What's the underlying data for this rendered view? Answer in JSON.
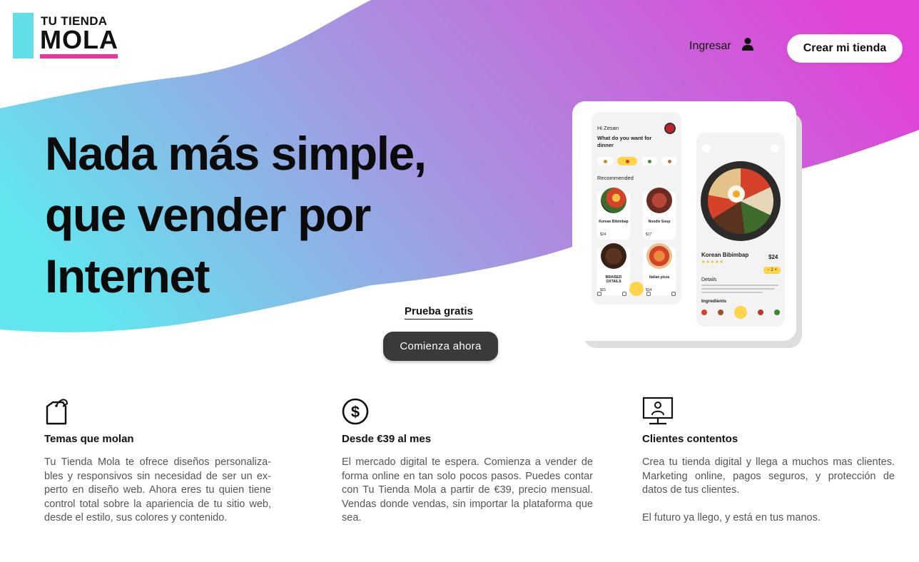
{
  "brand": {
    "line1": "TU TIENDA",
    "line2": "MOLA",
    "accent_cyan": "#62dfe6",
    "accent_pink": "#e8359f"
  },
  "header": {
    "login_label": "Ingresar",
    "login_icon": "user-icon",
    "create_store_label": "Crear mi tienda"
  },
  "hero": {
    "headline": [
      "Nada más simple,",
      "que vender por",
      "Internet"
    ],
    "trial_label": "Prueba gratis",
    "cta_label": "Comienza ahora",
    "gradient": [
      "#62e6ee",
      "#a78fe0",
      "#e043d6"
    ]
  },
  "mockup": {
    "home": {
      "greeting": "Hi Zesan",
      "question": "What do you want for dinner",
      "section": "Recommended",
      "items": [
        {
          "name": "Korean Bibimbap",
          "price": "$24"
        },
        {
          "name": "Noodle Soup",
          "price": "$17"
        },
        {
          "name": "BRAISED OXTAILS",
          "price": "$21"
        },
        {
          "name": "Italian pizza",
          "price": "$14"
        }
      ]
    },
    "detail": {
      "title": "Korean Bibimbap",
      "price": "$24",
      "rating": "★★★★★",
      "quantity": "− 2 +",
      "details_label": "Details",
      "ingredients_label": "Ingredients"
    }
  },
  "features": [
    {
      "icon": "tag-icon",
      "title": "Temas que molan",
      "paragraphs": [
        "Tu Tienda Mola te ofrece diseños personaliza-bles y responsivos sin necesidad de ser un ex-perto en diseño web. Ahora eres tu quien tiene control total sobre la apariencia de tu sitio web, desde el estilo, sus colores y contenido."
      ]
    },
    {
      "icon": "dollar-icon",
      "title": "Desde €39 al mes",
      "paragraphs": [
        "El mercado digital te espera. Comienza a vender de forma online en tan solo pocos pasos. Puedes contar con Tu Tienda Mola a partir de €39, precio mensual. Vendas donde vendas, sin importar la plataforma que sea."
      ]
    },
    {
      "icon": "monitor-user-icon",
      "title": "Clientes contentos",
      "paragraphs": [
        "Crea tu tienda digital y llega a muchos mas clientes. Marketing online, pagos seguros, y protección de datos de tus clientes.",
        "El futuro ya llego, y está en tus manos."
      ]
    }
  ]
}
